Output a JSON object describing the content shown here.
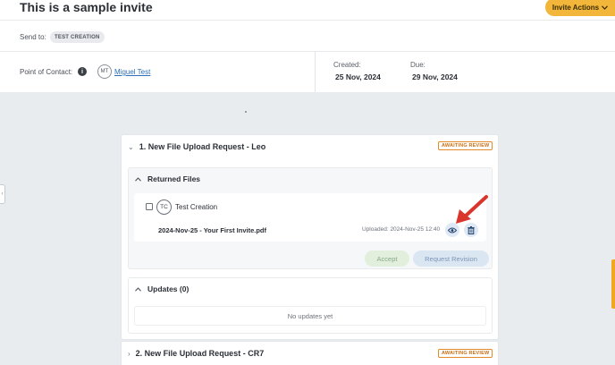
{
  "header": {
    "title": "This is a sample invite",
    "actions_label": "Invite Actions",
    "actions_icon": "chevron-down-icon"
  },
  "send_to": {
    "label": "Send to:",
    "chip": "TEST CREATION"
  },
  "contact": {
    "label": "Point of Contact:",
    "info_icon": "info-icon",
    "initials": "MT",
    "name": "Miguel Test"
  },
  "dates": {
    "created_label": "Created:",
    "created_value": "25 Nov, 2024",
    "due_label": "Due:",
    "due_value": "29 Nov, 2024"
  },
  "requests": [
    {
      "title": "1. New File Upload Request - Leo",
      "status": "AWAITING REVIEW",
      "expanded": true,
      "returned_files": {
        "title": "Returned Files",
        "uploader_initials": "TC",
        "uploader_name": "Test Creation",
        "file_name": "2024-Nov-25 - Your First Invite.pdf",
        "uploaded": "Uploaded: 2024-Nov-25 12:40",
        "accept_label": "Accept",
        "revision_label": "Request Revision"
      },
      "updates": {
        "title": "Updates (0)",
        "empty_text": "No updates yet"
      }
    },
    {
      "title": "2. New File Upload Request - CR7",
      "status": "AWAITING REVIEW",
      "expanded": false
    }
  ],
  "colors": {
    "accent": "#f1b63a",
    "status": "#e28a2b",
    "link": "#2e6fb7",
    "annotation_arrow": "#d9352c"
  }
}
